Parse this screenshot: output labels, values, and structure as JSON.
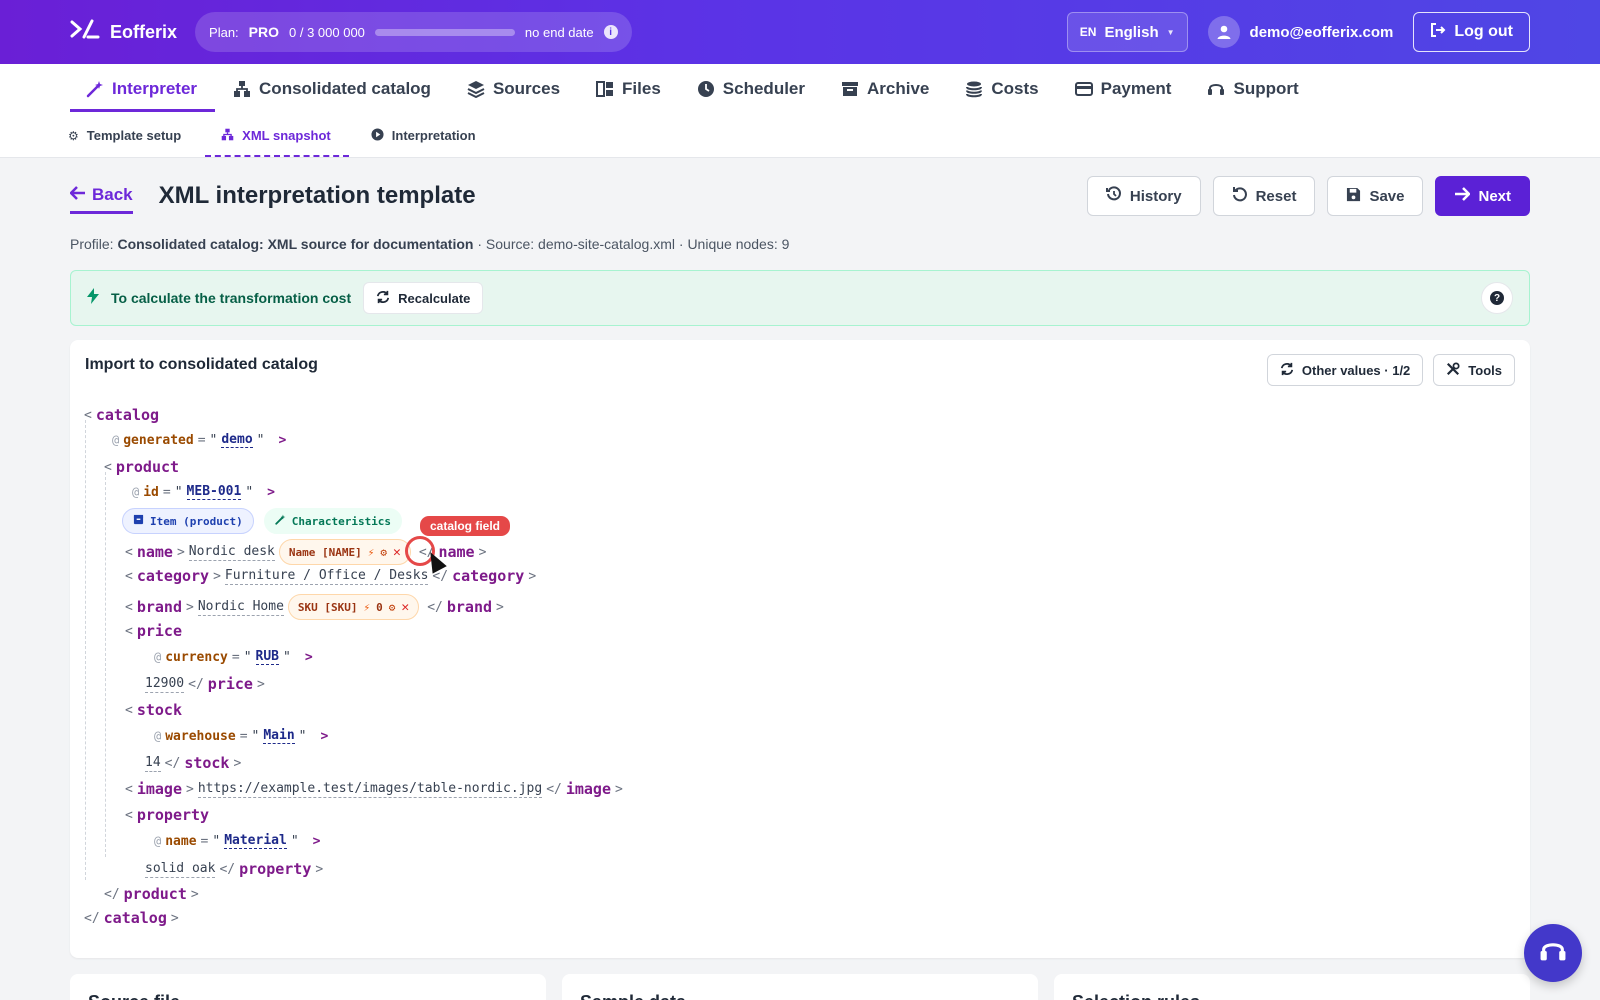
{
  "topbar": {
    "brand": "Eofferix",
    "plan_label": "Plan:",
    "plan_name": "PRO",
    "plan_usage": "0 / 3 000 000",
    "plan_progress": 0.0,
    "plan_expiry": "no end date",
    "lang_code": "EN",
    "lang_label": "English",
    "user_email": "demo@eofferix.com",
    "logout_label": "Log out",
    "colors": {
      "gradient_start": "#6a1fd6",
      "gradient_end": "#4f46e5"
    }
  },
  "mainnav": {
    "items": [
      {
        "label": "Interpreter",
        "icon": "magic-wand-icon",
        "active": true
      },
      {
        "label": "Consolidated catalog",
        "icon": "sitemap-icon"
      },
      {
        "label": "Sources",
        "icon": "layers-icon"
      },
      {
        "label": "Files",
        "icon": "files-icon"
      },
      {
        "label": "Scheduler",
        "icon": "clock-icon"
      },
      {
        "label": "Archive",
        "icon": "archive-icon"
      },
      {
        "label": "Costs",
        "icon": "coins-icon"
      },
      {
        "label": "Payment",
        "icon": "credit-card-icon"
      },
      {
        "label": "Support",
        "icon": "headset-icon"
      }
    ]
  },
  "subnav": {
    "items": [
      {
        "label": "Template setup",
        "icon": "gear-icon"
      },
      {
        "label": "XML snapshot",
        "icon": "sitemap-icon",
        "active": true
      },
      {
        "label": "Interpretation",
        "icon": "play-icon"
      }
    ]
  },
  "header": {
    "back_label": "Back",
    "title": "XML interpretation template",
    "history_label": "History",
    "reset_label": "Reset",
    "save_label": "Save",
    "next_label": "Next"
  },
  "profile": {
    "prefix": "Profile:",
    "name": "Consolidated catalog: XML source for documentation",
    "source": "· Source: demo-site-catalog.xml",
    "nodes": "· Unique nodes: 9"
  },
  "alert": {
    "text": "To calculate the transformation cost",
    "recalc_label": "Recalculate",
    "help": "?"
  },
  "card": {
    "title": "Import to consolidated catalog",
    "other_values_label": "Other values · 1/2",
    "tools_label": "Tools"
  },
  "xml": {
    "catalog_tag": "catalog",
    "generated_attr": "generated",
    "generated_val": "demo",
    "product_tag": "product",
    "id_attr": "id",
    "id_val": "MEB-001",
    "chip_item": "Item (product)",
    "chip_char": "Characteristics",
    "name_tag": "name",
    "name_val": "Nordic desk",
    "name_map": "Name [NAME]",
    "category_tag": "category",
    "category_val": "Furniture / Office / Desks",
    "brand_tag": "brand",
    "brand_val": "Nordic Home",
    "brand_map": "SKU [SKU]",
    "brand_map_count": "0",
    "price_tag": "price",
    "currency_attr": "currency",
    "currency_val": "RUB",
    "price_val": "12900",
    "stock_tag": "stock",
    "warehouse_attr": "warehouse",
    "warehouse_val": "Main",
    "stock_val": "14",
    "image_tag": "image",
    "image_val": "https://example.test/images/table-nordic.jpg",
    "property_tag": "property",
    "pname_attr": "name",
    "pname_val": "Material",
    "property_val": "solid oak",
    "tooltip": "catalog field"
  },
  "bottom_cards": [
    {
      "title": "Source file"
    },
    {
      "title": "Sample data"
    },
    {
      "title": "Selection rules"
    }
  ]
}
